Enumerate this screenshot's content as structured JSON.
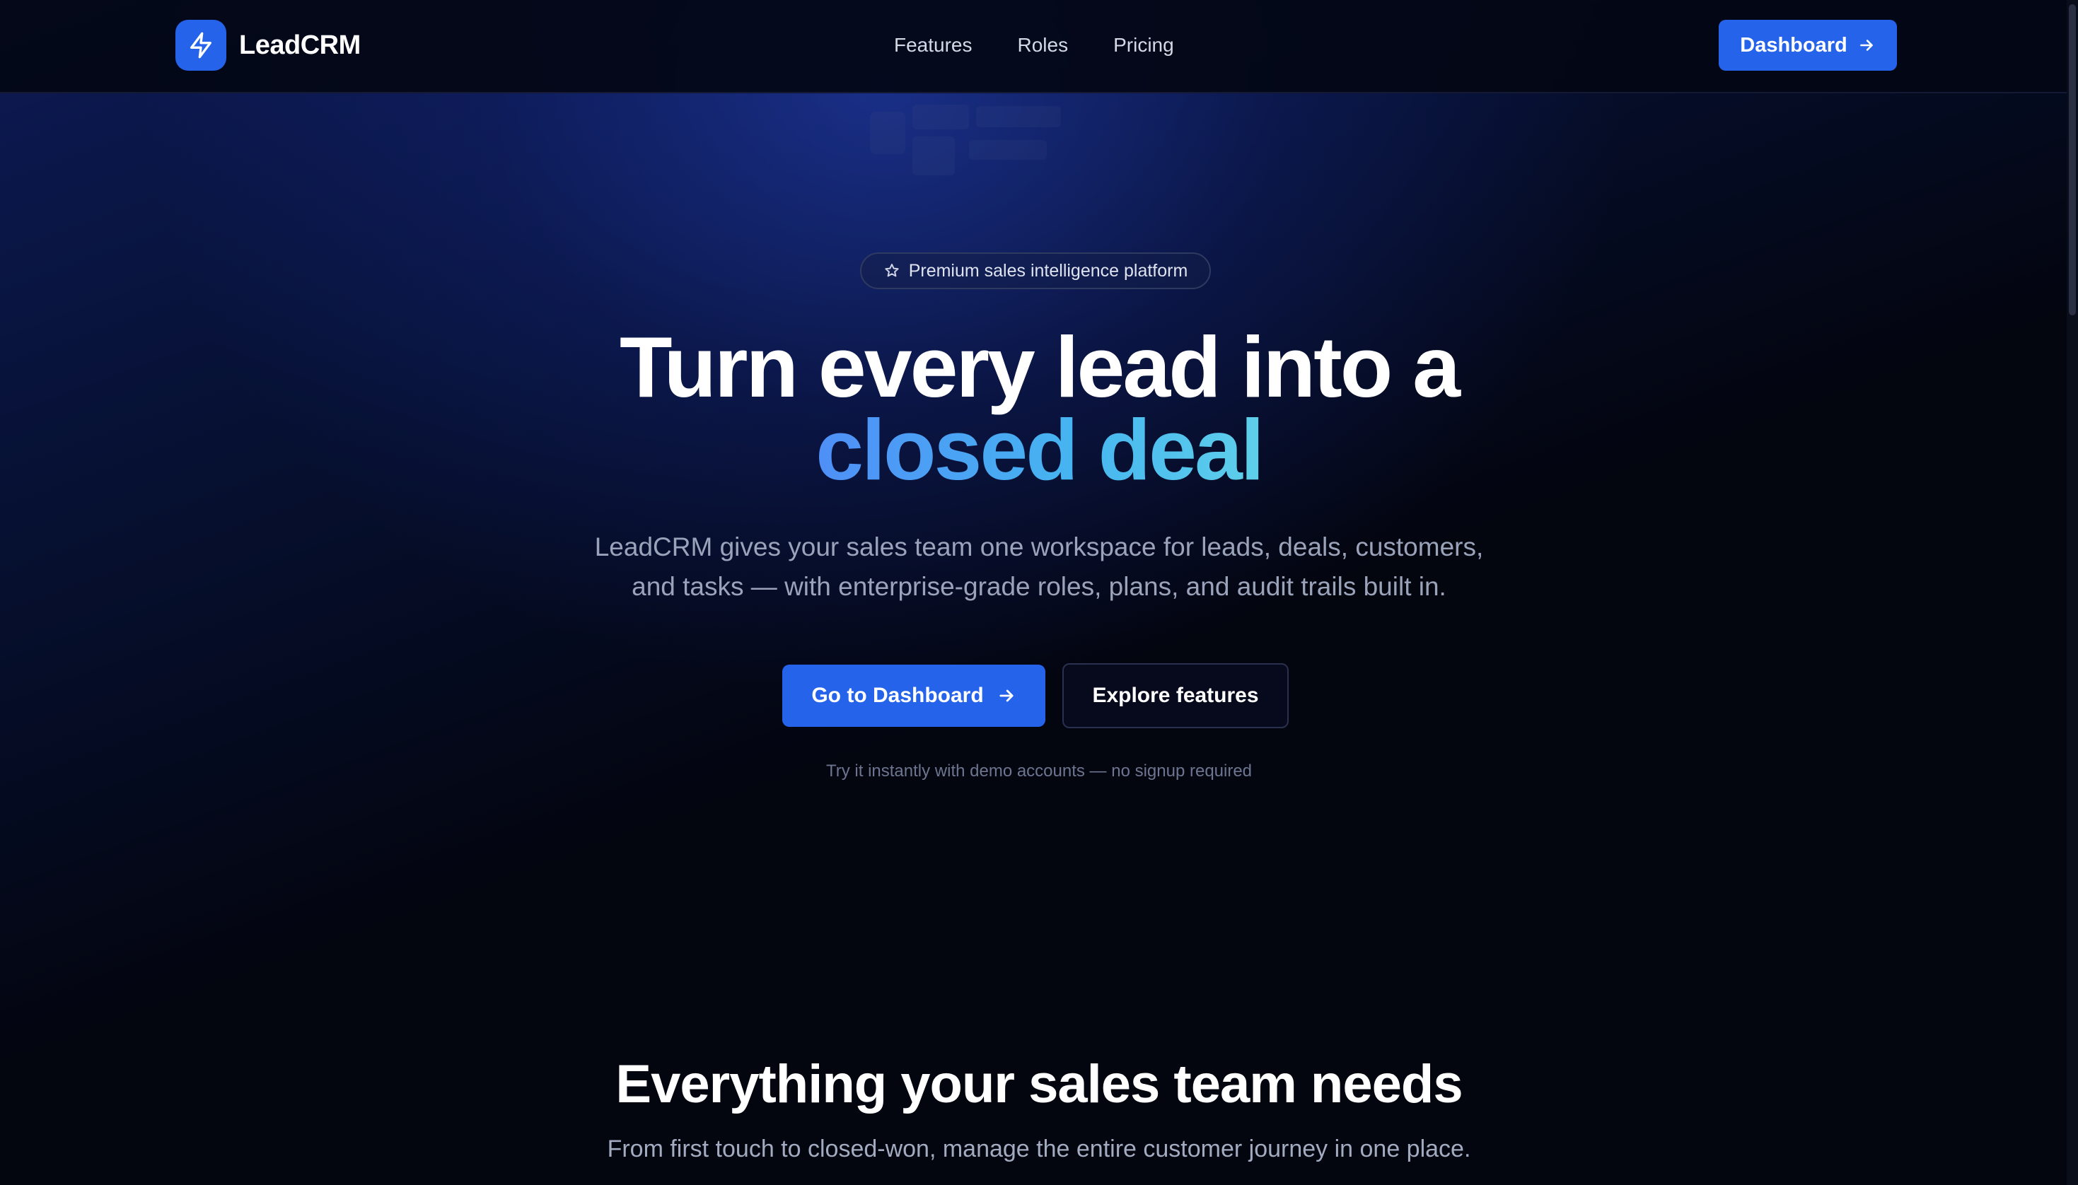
{
  "brand": {
    "name": "LeadCRM",
    "accent": "#2563eb",
    "logo_icon": "lightning-bolt-icon"
  },
  "nav": {
    "links": [
      {
        "label": "Features"
      },
      {
        "label": "Roles"
      },
      {
        "label": "Pricing"
      }
    ],
    "dashboard_label": "Dashboard",
    "dashboard_icon": "arrow-right-icon"
  },
  "hero": {
    "badge_icon": "star-icon",
    "badge_text": "Premium sales intelligence platform",
    "headline_line1": "Turn every lead into a",
    "headline_line2": "closed deal",
    "headline_gradient": [
      "#4f8ff7",
      "#5fd0ea"
    ],
    "lead_line1": "LeadCRM gives your sales team one workspace for leads, deals, customers,",
    "lead_line2": "and tasks — with enterprise-grade roles, plans, and audit trails built in.",
    "primary_cta": "Go to Dashboard",
    "secondary_cta": "Explore features",
    "note": "Try it instantly with demo accounts — no signup required"
  },
  "features": {
    "title": "Everything your sales team needs",
    "subtitle": "From first touch to closed-won, manage the entire customer journey in one place."
  }
}
